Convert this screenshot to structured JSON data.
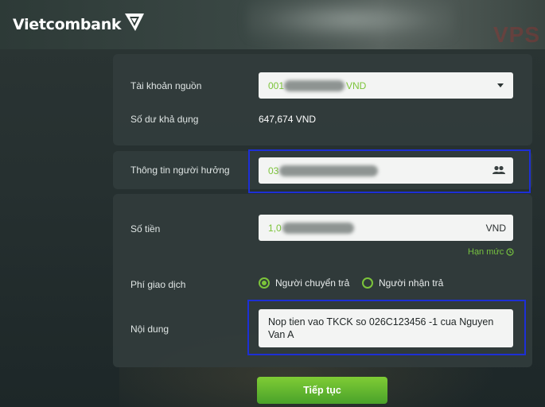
{
  "header": {
    "brand": "Vietcombank",
    "watermark": "VPS"
  },
  "source_account": {
    "label": "Tài khoản nguồn",
    "value_prefix": "001",
    "value_suffix": "VND"
  },
  "balance": {
    "label": "Số dư khả dụng",
    "value": "647,674 VND"
  },
  "beneficiary": {
    "label": "Thông tin người hưởng",
    "value_prefix": "03"
  },
  "amount": {
    "label": "Số tiền",
    "value_prefix": "1,0",
    "currency": "VND",
    "limit_link": "Hạn mức"
  },
  "fee": {
    "label": "Phí giao dịch",
    "options": [
      {
        "label": "Người chuyển trả",
        "selected": true
      },
      {
        "label": "Người nhận trả",
        "selected": false
      }
    ]
  },
  "content": {
    "label": "Nội dung",
    "value": "Nop tien vao TKCK so 026C123456 -1 cua Nguyen Van A"
  },
  "submit_label": "Tiếp tục",
  "colors": {
    "accent": "#7cc43a",
    "highlight": "#1d2fd6",
    "panel": "#323c3c"
  }
}
